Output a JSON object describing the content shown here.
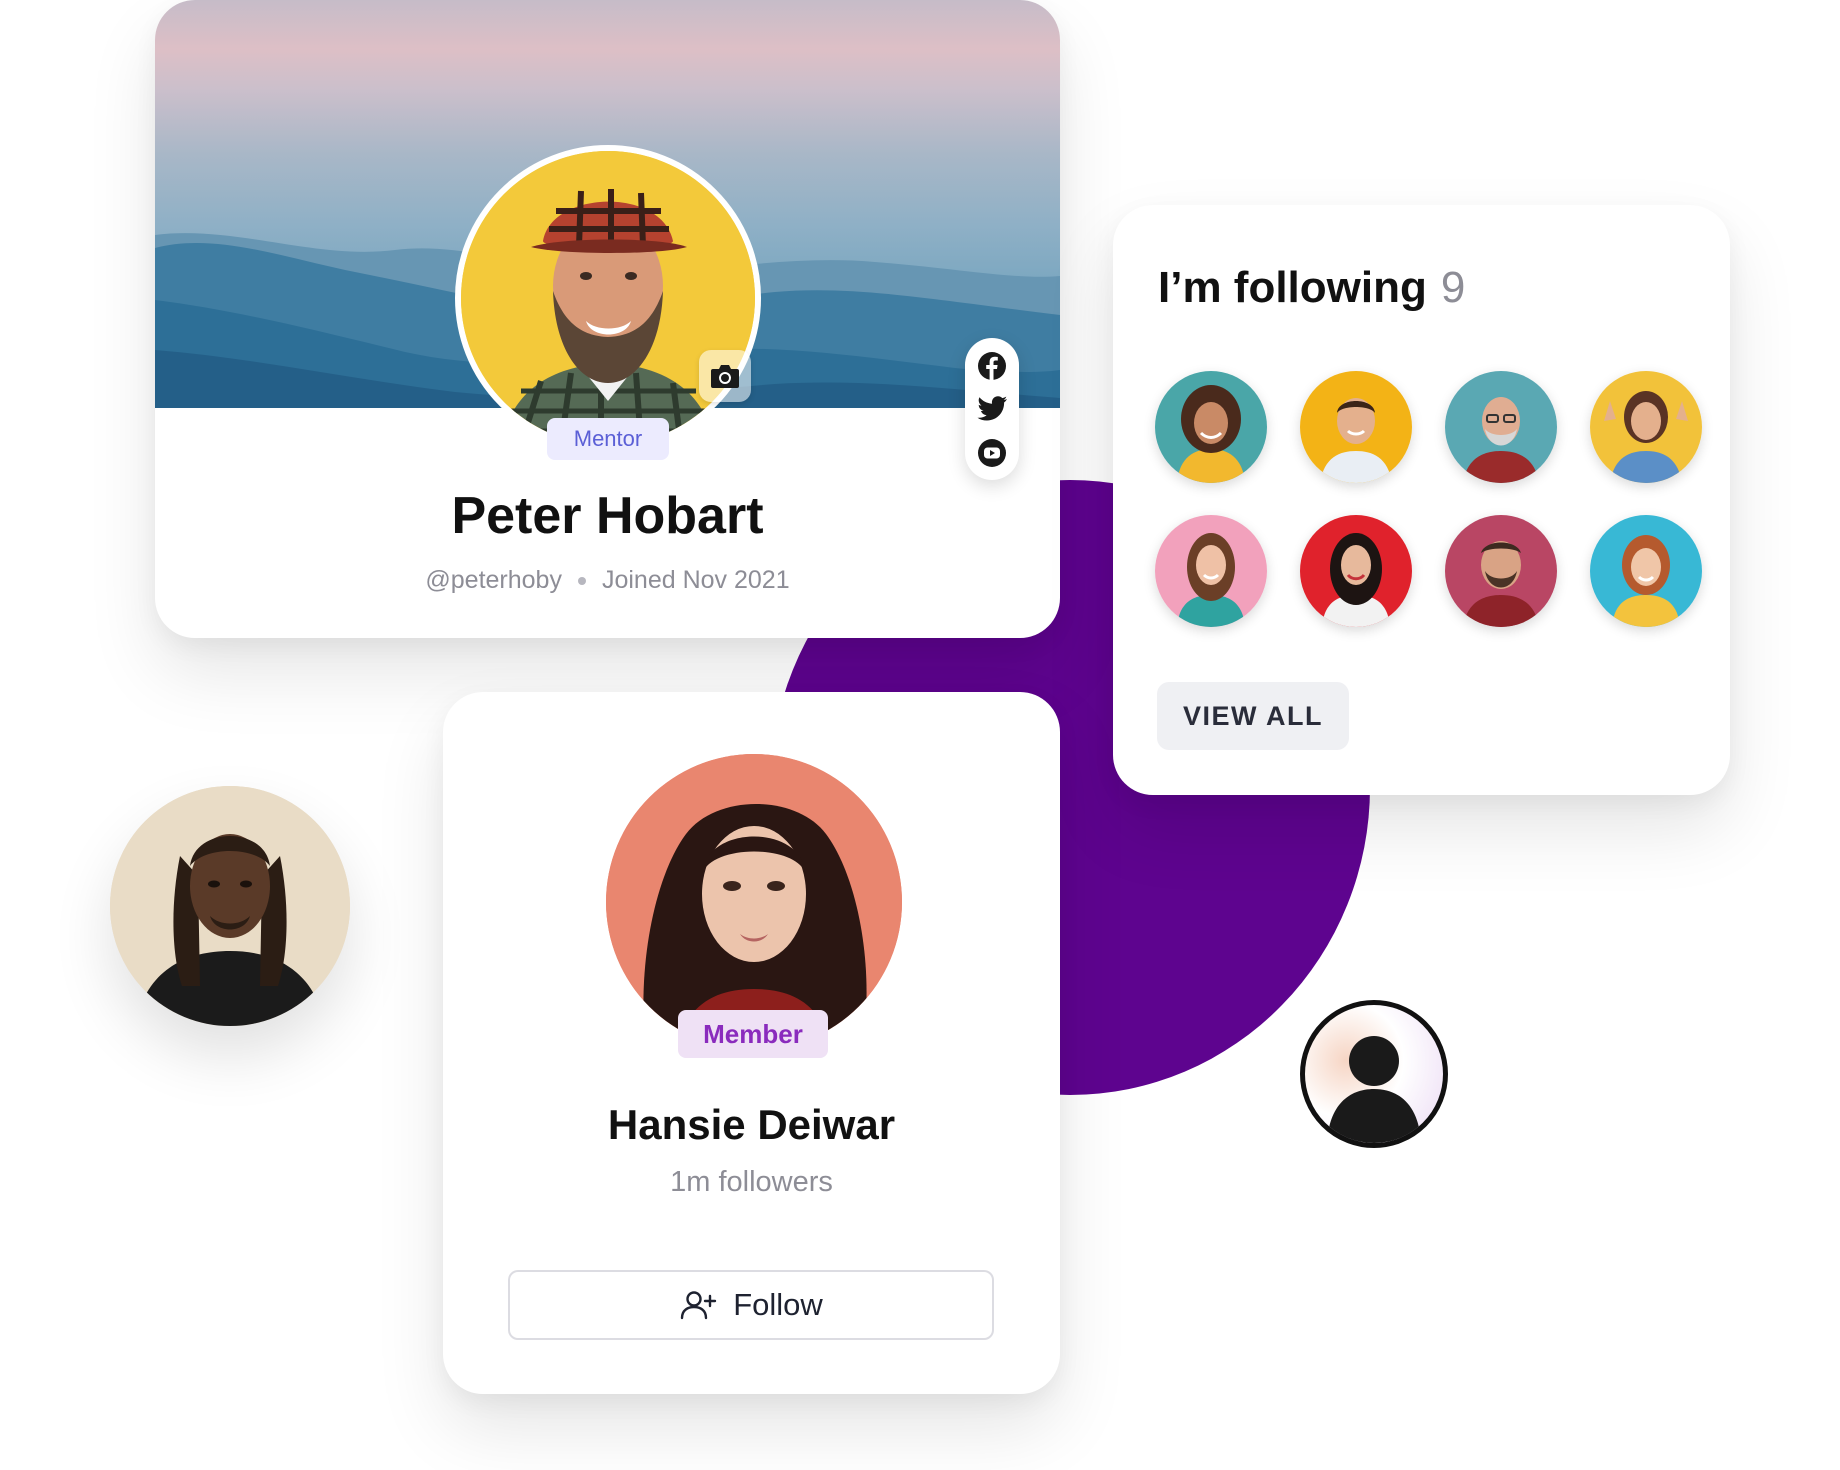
{
  "profile": {
    "name": "Peter Hobart",
    "handle": "@peterhoby",
    "joined": "Joined Nov 2021",
    "role": "Mentor",
    "social": [
      "facebook-icon",
      "twitter-icon",
      "youtube-icon"
    ]
  },
  "following": {
    "title": "I’m following",
    "count": "9",
    "avatars_bg": [
      "#4aa6a8",
      "#f3b316",
      "#5aa8b3",
      "#f2c23a",
      "#f2a1bc",
      "#e0222c",
      "#b94664",
      "#38b8d5"
    ],
    "view_all_label": "VIEW ALL"
  },
  "member": {
    "name": "Hansie Deiwar",
    "role": "Member",
    "followers": "1m followers",
    "follow_label": "Follow"
  },
  "colors": {
    "accent_purple": "#5e048f",
    "mentor_badge_text": "#5b5fd6",
    "member_badge_text": "#8a2bbd"
  }
}
